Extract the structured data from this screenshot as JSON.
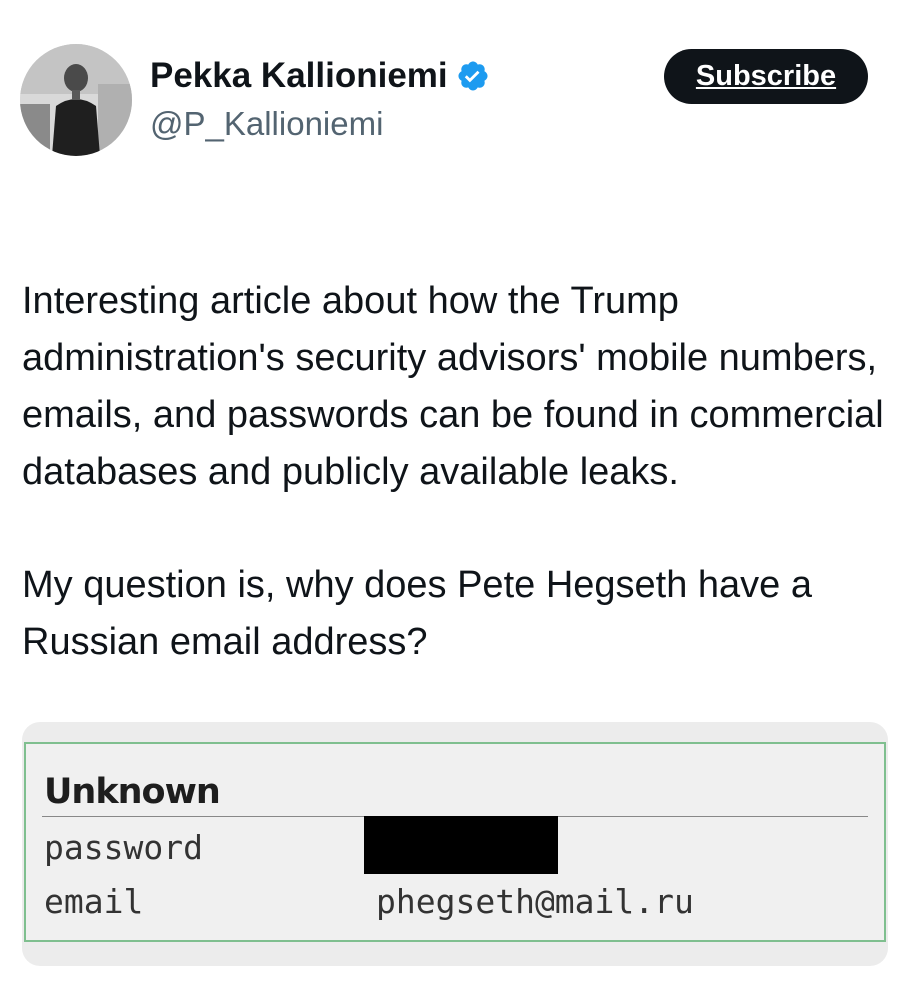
{
  "author": {
    "display_name": "Pekka Kallioniemi",
    "handle": "@P_Kallioniemi",
    "verified_icon": "verified-badge-icon",
    "accent_color": "#1d9bf0"
  },
  "actions": {
    "subscribe_label": "Subscribe"
  },
  "tweet": {
    "paragraph_1": "Interesting article about how the Trump administration's security advisors' mobile numbers, emails, and passwords can be found in commercial databases and publicly available leaks.",
    "paragraph_2": "My question is, why does Pete Hegseth have a Russian email address?"
  },
  "media": {
    "heading": "Unknown",
    "rows": [
      {
        "key": "password",
        "value": "",
        "redacted": true
      },
      {
        "key": "email",
        "value": "phegseth@mail.ru",
        "redacted": false
      }
    ]
  }
}
